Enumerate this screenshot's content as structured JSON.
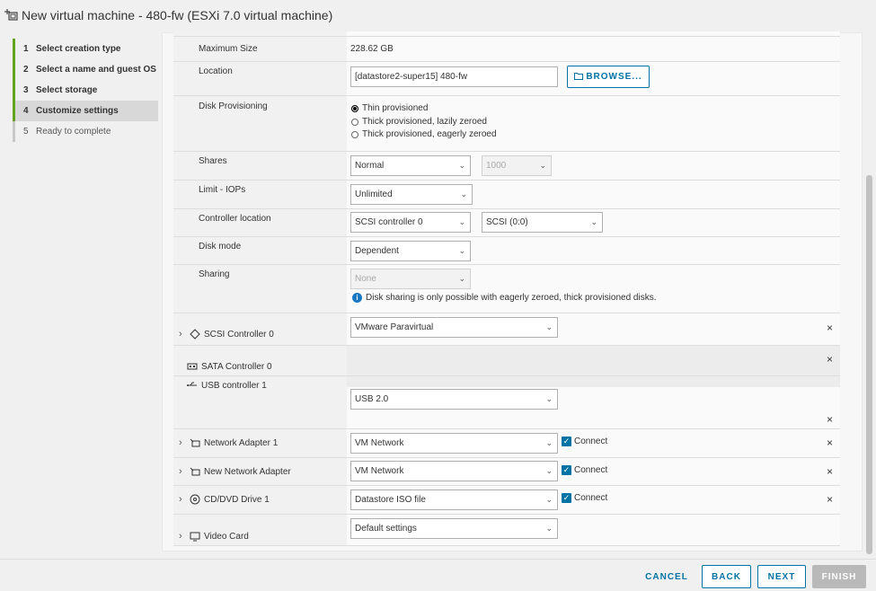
{
  "window": {
    "title": "New virtual machine - 480-fw (ESXi 7.0 virtual machine)"
  },
  "steps": [
    {
      "num": "1",
      "label": "Select creation type"
    },
    {
      "num": "2",
      "label": "Select a name and guest OS"
    },
    {
      "num": "3",
      "label": "Select storage"
    },
    {
      "num": "4",
      "label": "Customize settings"
    },
    {
      "num": "5",
      "label": "Ready to complete"
    }
  ],
  "disk": {
    "max_size_label": "Maximum Size",
    "max_size_value": "228.62 GB",
    "location_label": "Location",
    "location_value": "[datastore2-super15] 480-fw",
    "browse_label": "BROWSE...",
    "provisioning_label": "Disk Provisioning",
    "provisioning_options": [
      "Thin provisioned",
      "Thick provisioned, lazily zeroed",
      "Thick provisioned, eagerly zeroed"
    ],
    "provisioning_selected": 0,
    "shares_label": "Shares",
    "shares_value": "Normal",
    "shares_number": "1000",
    "limit_label": "Limit - IOPs",
    "limit_value": "Unlimited",
    "controller_label": "Controller location",
    "controller_value": "SCSI controller 0",
    "controller_slot": "SCSI (0:0)",
    "mode_label": "Disk mode",
    "mode_value": "Dependent",
    "sharing_label": "Sharing",
    "sharing_value": "None",
    "sharing_info": "Disk sharing is only possible with eagerly zeroed, thick provisioned disks."
  },
  "devices": {
    "scsi": {
      "label": "SCSI Controller 0",
      "value": "VMware Paravirtual"
    },
    "sata": {
      "label": "SATA Controller 0"
    },
    "usb": {
      "label": "USB controller 1",
      "value": "USB 2.0"
    },
    "net1": {
      "label": "Network Adapter 1",
      "value": "VM Network",
      "connect": "Connect"
    },
    "net2": {
      "label": "New Network Adapter",
      "value": "VM Network",
      "connect": "Connect"
    },
    "cd": {
      "label": "CD/DVD Drive 1",
      "value": "Datastore ISO file",
      "connect": "Connect"
    },
    "video": {
      "label": "Video Card",
      "value": "Default settings"
    }
  },
  "footer": {
    "cancel": "CANCEL",
    "back": "BACK",
    "next": "NEXT",
    "finish": "FINISH"
  },
  "colors": {
    "accent": "#0072a3",
    "step_done": "#62a420"
  }
}
